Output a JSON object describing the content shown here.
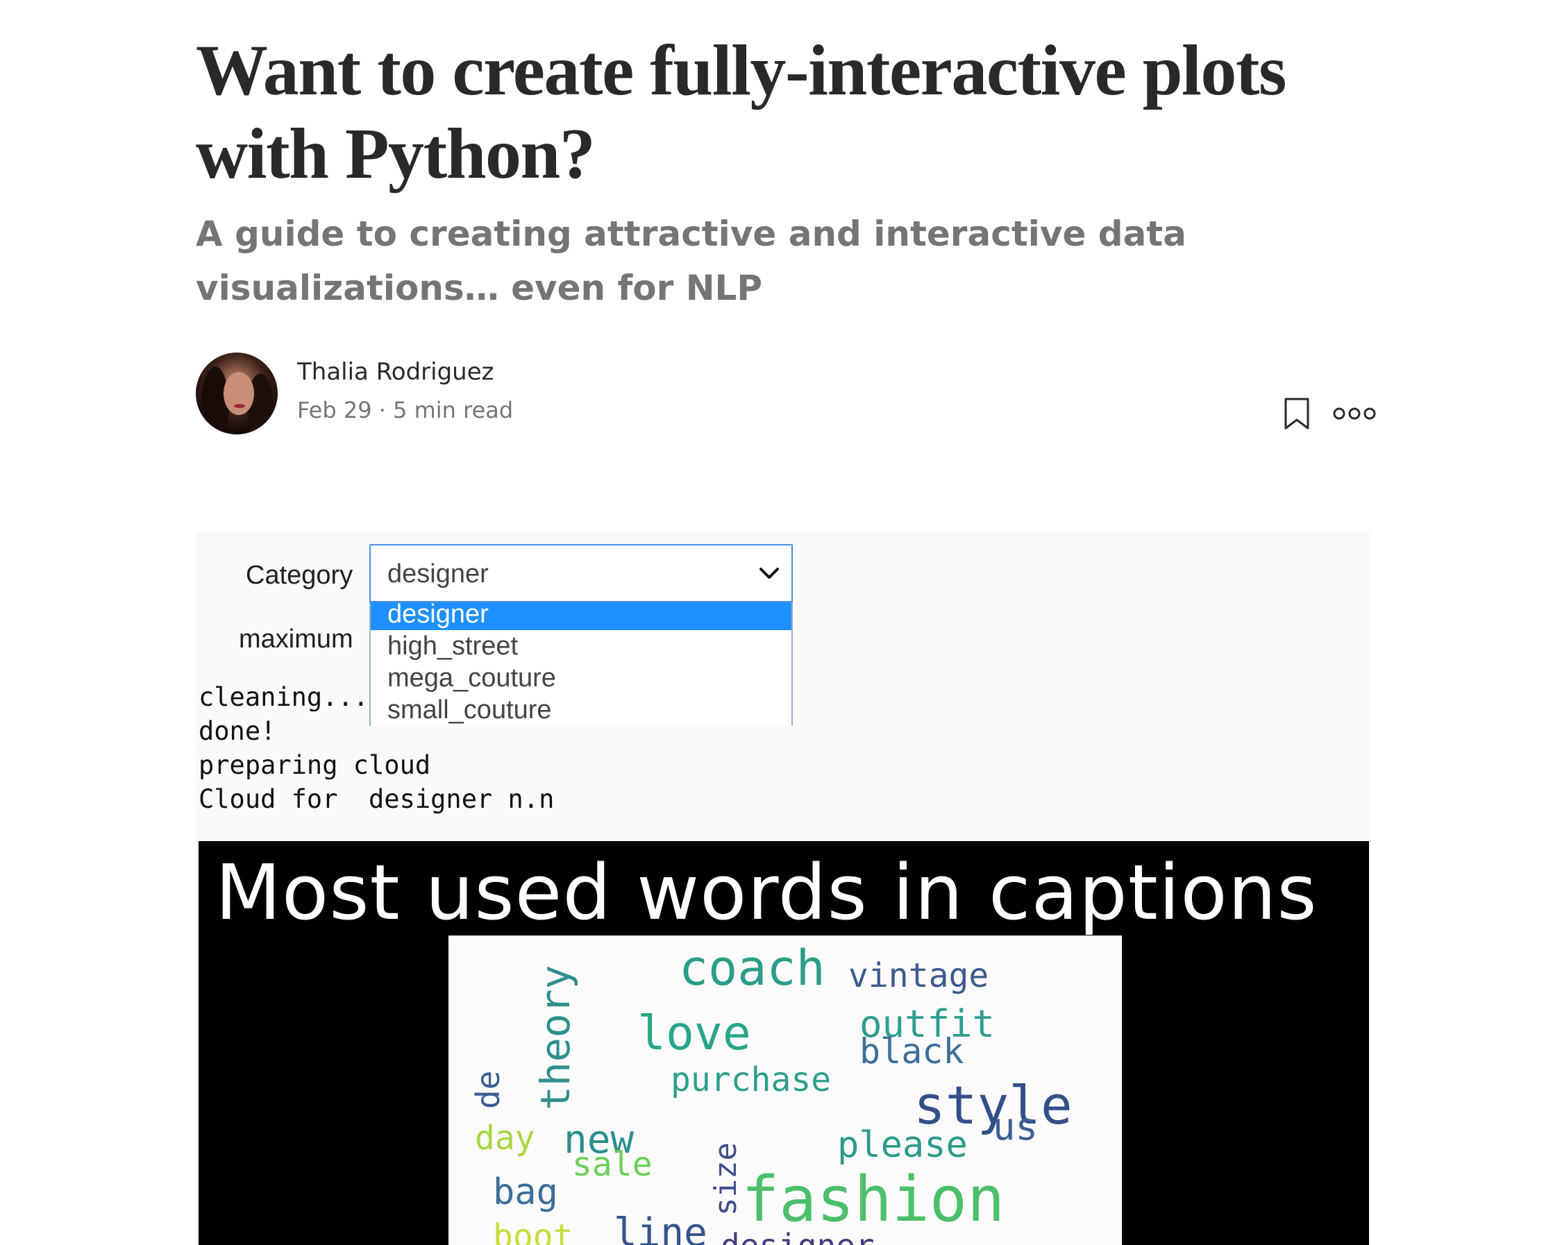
{
  "article": {
    "title": "Want to create fully-interactive plots with Python?",
    "subtitle": "A guide to creating attractive and interactive data visualizations… even for NLP",
    "author": "Thalia Rodriguez",
    "meta": "Feb 29 · 5 min read"
  },
  "icons": {
    "bookmark": "bookmark-icon",
    "more": "more-options-icon",
    "chevron": "chevron-down-icon"
  },
  "widget": {
    "category_label": "Category",
    "maximum_label": "maximum",
    "selected_value": "designer",
    "options": [
      "designer",
      "high_street",
      "mega_couture",
      "small_couture"
    ],
    "highlight_color": "#1e90ff"
  },
  "console": [
    "cleaning...",
    "done!",
    "preparing cloud",
    "Cloud for  designer n.n"
  ],
  "word_cloud": {
    "title": "Most used words in captions",
    "words": [
      {
        "text": "coach",
        "color": "#2a9d8a"
      },
      {
        "text": "vintage",
        "color": "#3e5a8e"
      },
      {
        "text": "theory",
        "color": "#2f8f8c"
      },
      {
        "text": "love",
        "color": "#28a68a"
      },
      {
        "text": "outfit",
        "color": "#2f9e90"
      },
      {
        "text": "black",
        "color": "#3c6f98"
      },
      {
        "text": "de",
        "color": "#3b5d93"
      },
      {
        "text": "purchase",
        "color": "#2e9f8c"
      },
      {
        "text": "style",
        "color": "#334f8a"
      },
      {
        "text": "us",
        "color": "#3c5f94"
      },
      {
        "text": "day",
        "color": "#a9d645"
      },
      {
        "text": "new",
        "color": "#2a8f8c"
      },
      {
        "text": "please",
        "color": "#2c9a8c"
      },
      {
        "text": "sale",
        "color": "#6ccf5a"
      },
      {
        "text": "size",
        "color": "#3f4e8a"
      },
      {
        "text": "bag",
        "color": "#3b6e9a"
      },
      {
        "text": "fashion",
        "color": "#4cbf6a"
      },
      {
        "text": "line",
        "color": "#33538c"
      },
      {
        "text": "boot",
        "color": "#c9dc3a"
      },
      {
        "text": "designer",
        "color": "#463a80"
      }
    ]
  }
}
